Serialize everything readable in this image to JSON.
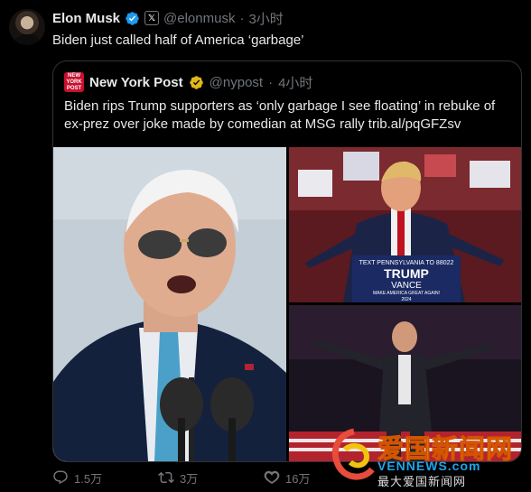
{
  "tweet": {
    "author_name": "Elon Musk",
    "handle": "@elonmusk",
    "separator": "·",
    "time": "3小时",
    "text": "Biden just called half of America ‘garbage’"
  },
  "quoted": {
    "author_name": "New York Post",
    "logo_line1": "NEW",
    "logo_line2": "YORK",
    "logo_line3": "POST",
    "handle": "@nypost",
    "separator": "·",
    "time": "4小时",
    "text": "Biden rips Trump supporters as ‘only garbage I see floating’ in rebuke of ex-prez over joke made by comedian at MSG rally trib.al/pqGFZsv"
  },
  "photos": {
    "top_right_sign_line1": "TEXT PENNSYLVANIA TO 88022",
    "top_right_sign_line2": "TRUMP",
    "top_right_sign_line3": "VANCE",
    "top_right_sign_line4": "MAKE AMERICA GREAT AGAIN!",
    "top_right_sign_line5": "2024"
  },
  "actions": {
    "replies": "1.5万",
    "reposts": "3万",
    "likes": "16万"
  },
  "watermark": {
    "cn": "爱国新闻网",
    "en": "VENNEWS.com",
    "sub": "最大爱国新闻网"
  },
  "colors": {
    "verified_blue": "#1d9bf0",
    "verified_gold": "#e2b719",
    "muted": "#71767b",
    "nyp_red": "#c8102e"
  }
}
